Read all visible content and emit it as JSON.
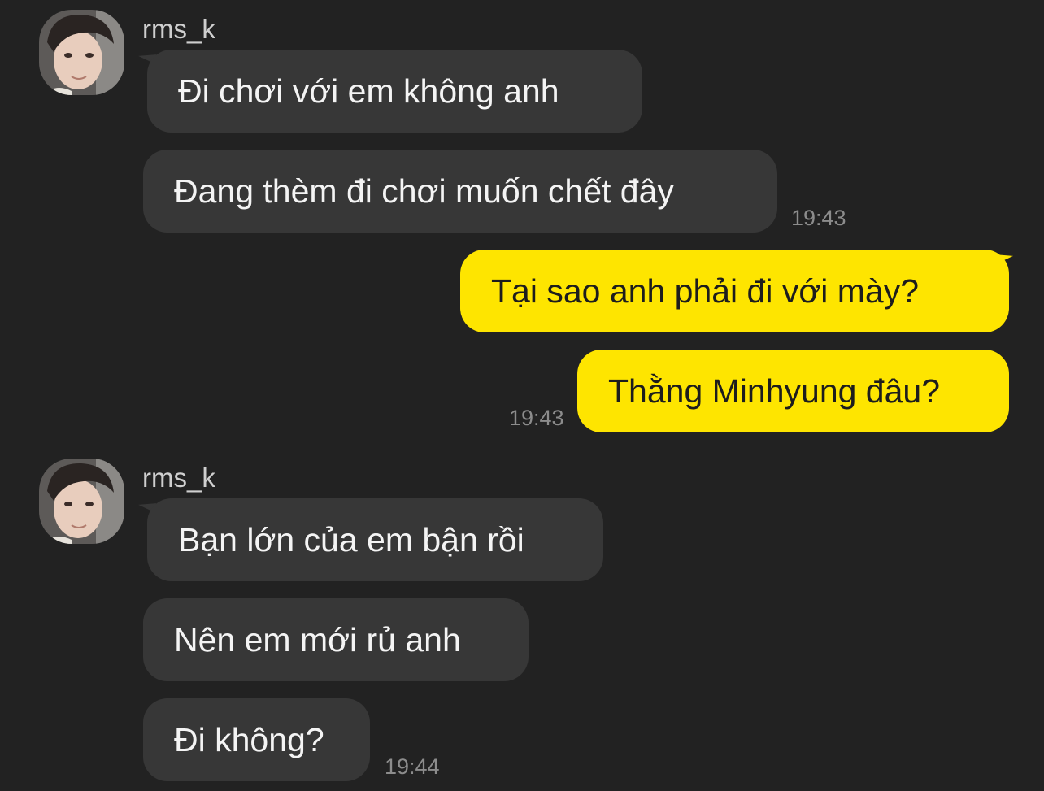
{
  "theme": {
    "background": "#222222",
    "incoming_bubble": "#373737",
    "outgoing_bubble": "#fee500",
    "timestamp_color": "#8c8c8c"
  },
  "groups": [
    {
      "sender": "rms_k",
      "avatar_icon": "profile-photo",
      "messages": [
        {
          "text": "Đi chơi với em không anh"
        },
        {
          "text": "Đang thèm đi chơi muốn chết đây"
        }
      ],
      "time": "19:43"
    },
    {
      "sender": "me",
      "messages": [
        {
          "text": "Tại sao anh phải đi với mày?"
        },
        {
          "text": "Thằng Minhyung đâu?"
        }
      ],
      "time": "19:43"
    },
    {
      "sender": "rms_k",
      "avatar_icon": "profile-photo",
      "messages": [
        {
          "text": "Bạn lớn của em bận rồi"
        },
        {
          "text": "Nên em mới rủ anh"
        },
        {
          "text": "Đi không?"
        }
      ],
      "time": "19:44"
    }
  ]
}
